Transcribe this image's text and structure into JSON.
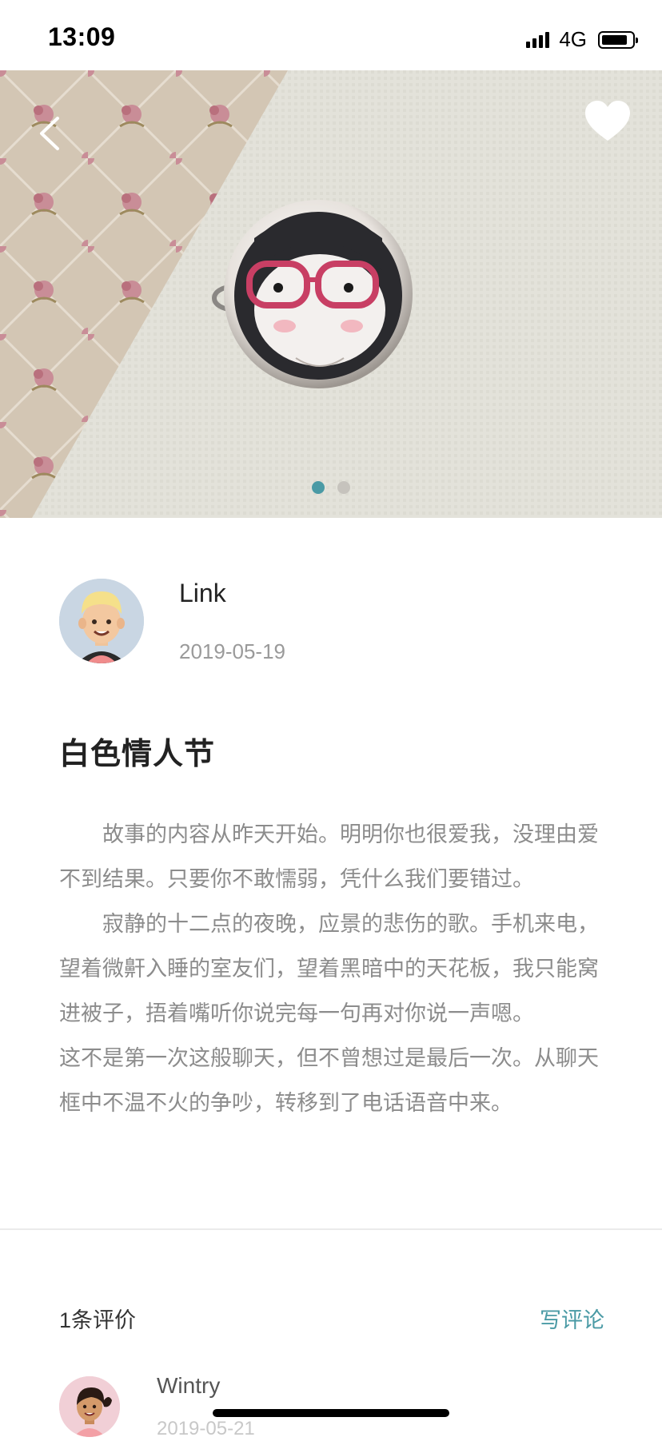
{
  "status_bar": {
    "time": "13:09",
    "network": "4G"
  },
  "hero": {
    "slides": 2,
    "active_slide": 1,
    "back_icon": "chevron-left-icon",
    "favorite_icon": "heart-icon"
  },
  "author": {
    "name": "Link",
    "date": "2019-05-19"
  },
  "post": {
    "title": "白色情人节",
    "paragraphs": [
      "故事的内容从昨天开始。明明你也很爱我，没理由爱不到结果。只要你不敢懦弱，凭什么我们要错过。",
      "寂静的十二点的夜晚，应景的悲伤的歌。手机来电，望着微鼾入睡的室友们，望着黑暗中的天花板，我只能窝进被子，捂着嘴听你说完每一句再对你说一声嗯。　　　这不是第一次这般聊天，但不曾想过是最后一次。从聊天框中不温不火的争吵，转移到了电话语音中来。"
    ]
  },
  "reviews": {
    "count_label": "1条评价",
    "write_label": "写评论"
  },
  "comments": [
    {
      "name": "Wintry",
      "date": "2019-05-21"
    }
  ],
  "colors": {
    "accent": "#4a9aa5",
    "text_primary": "#222222",
    "text_secondary": "#8c8c8c"
  }
}
